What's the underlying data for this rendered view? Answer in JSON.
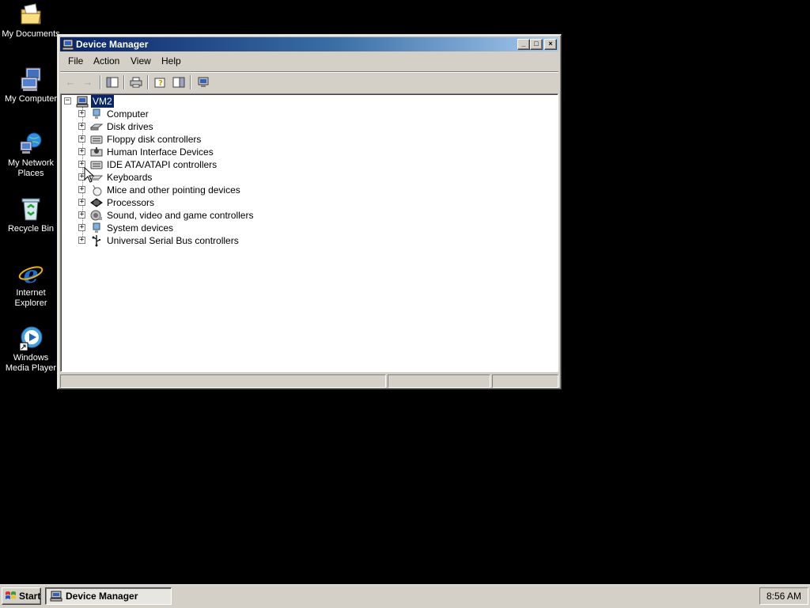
{
  "desktop": {
    "icons": [
      {
        "label": "My Documents",
        "icon": "my-documents-icon"
      },
      {
        "label": "My Computer",
        "icon": "my-computer-icon"
      },
      {
        "label": "My Network Places",
        "label_line1": "My Network",
        "label_line2": "Places",
        "icon": "network-places-icon"
      },
      {
        "label": "Recycle Bin",
        "icon": "recycle-bin-icon"
      },
      {
        "label": "Internet Explorer",
        "label_line1": "Internet",
        "label_line2": "Explorer",
        "icon": "internet-explorer-icon"
      },
      {
        "label": "Windows Media Player",
        "label_line1": "Windows",
        "label_line2": "Media Player",
        "icon": "media-player-icon"
      }
    ]
  },
  "window": {
    "title": "Device Manager",
    "controls": {
      "minimize": "_",
      "maximize": "□",
      "close": "×"
    },
    "menu": [
      "File",
      "Action",
      "View",
      "Help"
    ],
    "toolbar": [
      {
        "name": "back-icon",
        "glyph": "←",
        "enabled": false
      },
      {
        "name": "forward-icon",
        "glyph": "→",
        "enabled": false
      },
      {
        "name": "show-hide-tree-icon",
        "glyph": "▥",
        "enabled": true
      },
      {
        "name": "print-icon",
        "glyph": "⎙",
        "enabled": true
      },
      {
        "name": "properties-icon",
        "glyph": "?",
        "enabled": true
      },
      {
        "name": "help-icon",
        "glyph": "▤",
        "enabled": true
      },
      {
        "name": "scan-hardware-icon",
        "glyph": "▣",
        "enabled": true
      }
    ],
    "tree": {
      "root": "VM2",
      "items": [
        {
          "label": "Computer",
          "icon": "computer-icon"
        },
        {
          "label": "Disk drives",
          "icon": "disk-drive-icon"
        },
        {
          "label": "Floppy disk controllers",
          "icon": "controller-icon"
        },
        {
          "label": "Human Interface Devices",
          "icon": "hid-icon"
        },
        {
          "label": "IDE ATA/ATAPI controllers",
          "icon": "controller-icon"
        },
        {
          "label": "Keyboards",
          "icon": "keyboard-icon"
        },
        {
          "label": "Mice and other pointing devices",
          "icon": "mouse-icon"
        },
        {
          "label": "Processors",
          "icon": "processor-icon"
        },
        {
          "label": "Sound, video and game controllers",
          "icon": "sound-icon"
        },
        {
          "label": "System devices",
          "icon": "system-device-icon"
        },
        {
          "label": "Universal Serial Bus controllers",
          "icon": "usb-icon"
        }
      ]
    }
  },
  "taskbar": {
    "start_label": "Start",
    "tasks": [
      {
        "label": "Device Manager"
      }
    ],
    "clock": "8:56 AM"
  }
}
